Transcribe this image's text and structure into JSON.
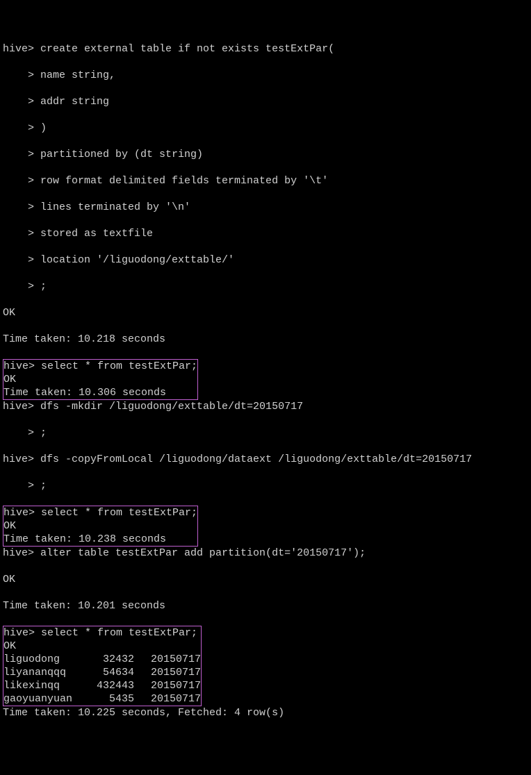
{
  "create_block": {
    "l0": "hive> create external table if not exists testExtPar(",
    "l1": "    > name string,",
    "l2": "    > addr string",
    "l3": "    > )",
    "l4": "    > partitioned by (dt string)",
    "l5": "    > row format delimited fields terminated by '\\t'",
    "l6": "    > lines terminated by '\\n'",
    "l7": "    > stored as textfile",
    "l8": "    > location '/liguodong/exttable/'",
    "l9": "    > ;",
    "ok": "OK",
    "time": "Time taken: 10.218 seconds"
  },
  "sel1": {
    "cmd": "hive> select * from testExtPar;",
    "ok": "OK",
    "time": "Time taken: 10.306 seconds"
  },
  "dfs": {
    "mkdir": "hive> dfs -mkdir /liguodong/exttable/dt=20150717",
    "mkdir_cont": "    > ;",
    "copy": "hive> dfs -copyFromLocal /liguodong/dataext /liguodong/exttable/dt=20150717",
    "copy_cont": "    > ;"
  },
  "sel2": {
    "cmd": "hive> select * from testExtPar;",
    "ok": "OK",
    "time": "Time taken: 10.238 seconds"
  },
  "alter": {
    "cmd": "hive> alter table testExtPar add partition(dt='20150717');",
    "ok": "OK",
    "time": "Time taken: 10.201 seconds"
  },
  "sel3": {
    "cmd": "hive> select * from testExtPar;",
    "ok": "OK",
    "rows": [
      {
        "name": "liguodong",
        "v": "32432",
        "dt": "20150717"
      },
      {
        "name": "liyananqqq",
        "v": "54634",
        "dt": "20150717"
      },
      {
        "name": "likexinqq",
        "v": "432443",
        "dt": "20150717"
      },
      {
        "name": "gaoyuanyuan",
        "v": "5435",
        "dt": "20150717"
      }
    ]
  },
  "final_time": "Time taken: 10.225 seconds, Fetched: 4 row(s)"
}
